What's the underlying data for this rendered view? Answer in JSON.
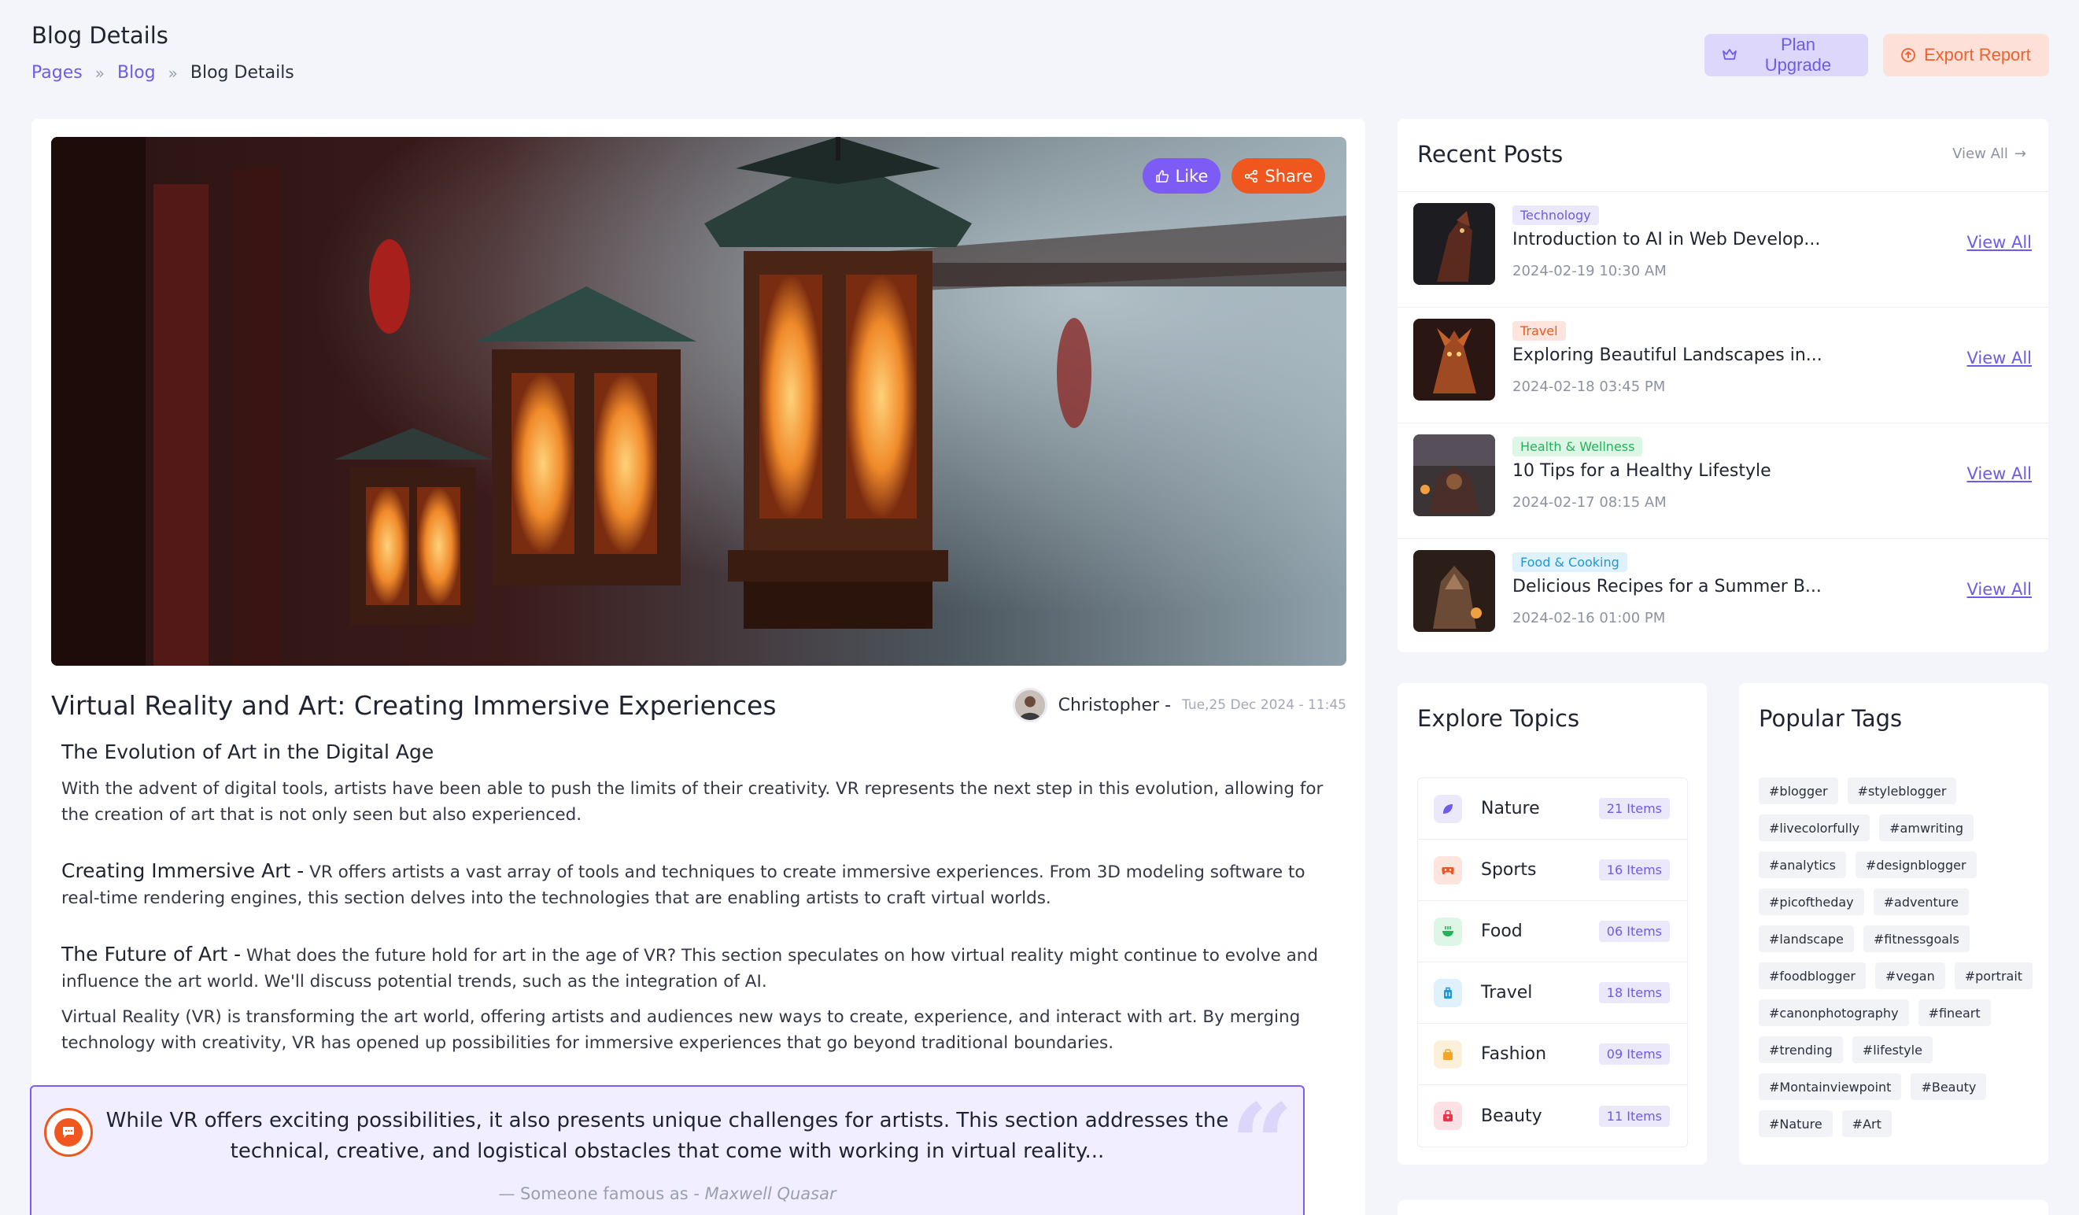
{
  "page": {
    "title": "Blog Details",
    "breadcrumb": [
      "Pages",
      "Blog",
      "Blog Details"
    ]
  },
  "header_actions": {
    "upgrade_label": "Plan Upgrade",
    "export_label": "Export Report"
  },
  "post": {
    "like_label": "Like",
    "share_label": "Share",
    "title": "Virtual Reality and Art: Creating Immersive Experiences",
    "author": "Christopher -",
    "date": "Tue,25 Dec 2024 - 11:45",
    "section_heading": "The Evolution of Art in the Digital Age",
    "section_text": "With the advent of digital tools, artists have been able to push the limits of their creativity. VR represents the next step in this evolution, allowing for the creation of art that is not only seen but also experienced.",
    "immersive_lead": "Creating Immersive Art -",
    "immersive_text": "VR offers artists a vast array of tools and techniques to create immersive experiences. From 3D modeling software to real-time rendering engines, this section delves into the technologies that are enabling artists to craft virtual worlds.",
    "future_lead": "The Future of Art -",
    "future_text": "What does the future hold for art in the age of VR? This section speculates on how virtual reality might continue to evolve and influence the art world. We'll discuss potential trends, such as the integration of AI.",
    "summary_text": "Virtual Reality (VR) is transforming the art world, offering artists and audiences new ways to create, experience, and interact with art. By merging technology with creativity, VR has opened up possibilities for immersive experiences that go beyond traditional boundaries.",
    "quote_text": "While VR offers exciting possibilities, it also presents unique challenges for artists. This section addresses the technical, creative, and logistical obstacles that come with working in virtual reality...",
    "quote_prefix": "— Someone famous as -",
    "quote_author": "Maxwell Quasar"
  },
  "recent_posts": {
    "title": "Recent Posts",
    "view_all": "View All",
    "items": [
      {
        "badge": "Technology",
        "badge_bg": "#ebe8fc",
        "badge_color": "#6c5ce7",
        "title": "Introduction to AI in Web Develop...",
        "date": "2024-02-19 10:30 AM",
        "link": "View All"
      },
      {
        "badge": "Travel",
        "badge_bg": "#fde4dc",
        "badge_color": "#f0571e",
        "title": "Exploring Beautiful Landscapes in...",
        "date": "2024-02-18 03:45 PM",
        "link": "View All"
      },
      {
        "badge": "Health & Wellness",
        "badge_bg": "#ddf6e6",
        "badge_color": "#22b35a",
        "title": "10 Tips for a Healthy Lifestyle",
        "date": "2024-02-17 08:15 AM",
        "link": "View All"
      },
      {
        "badge": "Food & Cooking",
        "badge_bg": "#dff1fb",
        "badge_color": "#1e98d6",
        "title": "Delicious Recipes for a Summer B...",
        "date": "2024-02-16 01:00 PM",
        "link": "View All"
      }
    ]
  },
  "explore_topics": {
    "title": "Explore Topics",
    "items": [
      {
        "icon": "leaf-icon",
        "color": "#6c5ce7",
        "bg": "#ebe8fc",
        "name": "Nature",
        "count": "21 Items"
      },
      {
        "icon": "gamepad-icon",
        "color": "#f0571e",
        "bg": "#fde4dc",
        "name": "Sports",
        "count": "16 Items"
      },
      {
        "icon": "food-icon",
        "color": "#22b35a",
        "bg": "#ddf6e6",
        "name": "Food",
        "count": "06 Items"
      },
      {
        "icon": "luggage-icon",
        "color": "#1e98d6",
        "bg": "#dff1fb",
        "name": "Travel",
        "count": "18 Items"
      },
      {
        "icon": "bag-icon",
        "color": "#f5a623",
        "bg": "#fdf0da",
        "name": "Fashion",
        "count": "09 Items"
      },
      {
        "icon": "beauty-icon",
        "color": "#e8354a",
        "bg": "#fde0e4",
        "name": "Beauty",
        "count": "11 Items"
      }
    ]
  },
  "popular_tags": {
    "title": "Popular Tags",
    "tags": [
      "#blogger",
      "#styleblogger",
      "#livecolorfully",
      "#amwriting",
      "#analytics",
      "#designblogger",
      "#picoftheday",
      "#adventure",
      "#landscape",
      "#fitnessgoals",
      "#foodblogger",
      "#vegan",
      "#portrait",
      "#canonphotography",
      "#fineart",
      "#trending",
      "#lifestyle",
      "#Montainviewpoint",
      "#Beauty",
      "#Nature",
      "#Art"
    ]
  }
}
